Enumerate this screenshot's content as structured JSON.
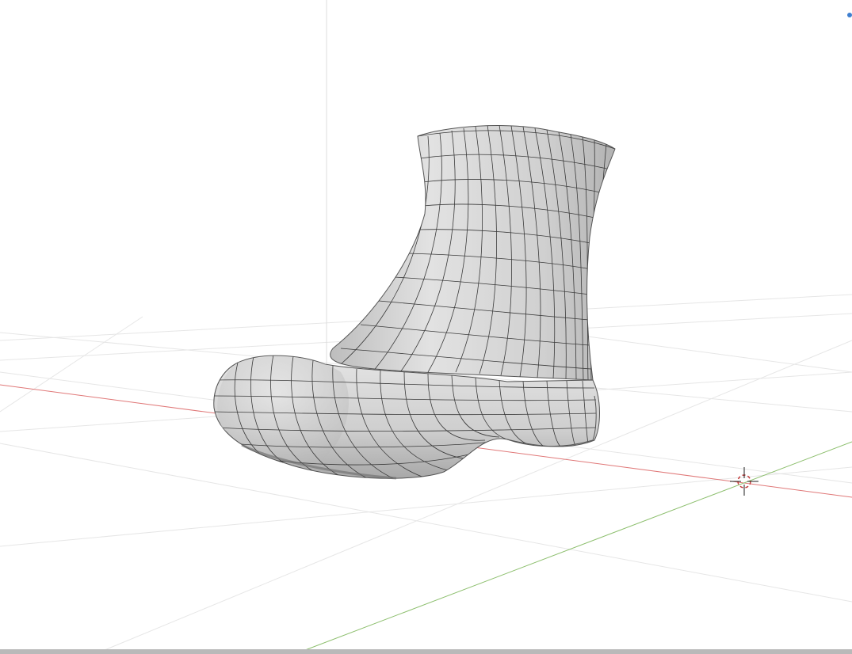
{
  "viewport": {
    "background_color": "#ffffff",
    "grid_color": "#e6e6e6",
    "x_axis_color": "#e07878",
    "y_axis_color": "#8dbf6e",
    "vertical_line_color": "#dcdcdc",
    "bottom_bar_color": "#b9b9b9",
    "indicator_color": "#3f7fd0"
  },
  "model": {
    "object": "boot-mesh",
    "shading": "wireframe-on-shaded",
    "surface_color": "#d8d8d8",
    "wire_color": "#3a3a3a"
  },
  "icons": {
    "cursor": "3d-cursor-icon",
    "indicator": "viewport-indicator-icon"
  }
}
